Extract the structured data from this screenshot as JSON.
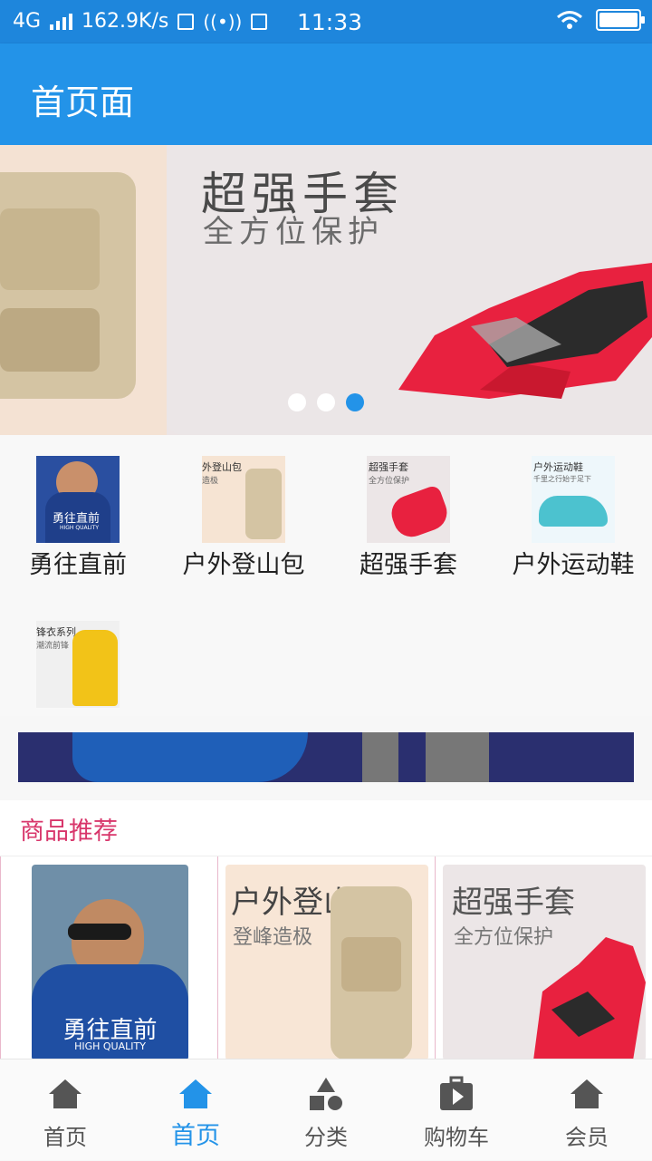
{
  "status_bar": {
    "network": "4G",
    "speed": "162.9K/s",
    "time": "11:33"
  },
  "app_bar": {
    "title": "首页面"
  },
  "banner": {
    "headline": "超强手套",
    "subline": "全方位保护",
    "slide_count": 3,
    "active_slide": 3
  },
  "categories": [
    {
      "label": "勇往直前",
      "thumb_text": "勇往直前",
      "thumb_sub": "HIGH QUALITY"
    },
    {
      "label": "户外登山包",
      "thumb_text": "外登山包",
      "thumb_sub": "造极"
    },
    {
      "label": "超强手套",
      "thumb_text": "超强手套",
      "thumb_sub": "全方位保护"
    },
    {
      "label": "户外运动鞋",
      "thumb_text": "户外运动鞋",
      "thumb_sub": "千里之行始于足下"
    },
    {
      "label": "",
      "thumb_text": "锋衣系列",
      "thumb_sub": "潮流前锋"
    }
  ],
  "recommend": {
    "title": "商品推荐",
    "items": [
      {
        "headline": "勇往直前",
        "sub": "HIGH QUALITY"
      },
      {
        "headline": "户外登山包",
        "sub": "登峰造极"
      },
      {
        "headline": "超强手套",
        "sub": "全方位保护"
      }
    ]
  },
  "bottom_nav": [
    {
      "label": "首页",
      "icon": "home-icon",
      "active": false
    },
    {
      "label": "首页",
      "icon": "home-icon",
      "active": true
    },
    {
      "label": "分类",
      "icon": "shapes-icon",
      "active": false
    },
    {
      "label": "购物车",
      "icon": "shopping-bag-icon",
      "active": false
    },
    {
      "label": "会员",
      "icon": "home-icon",
      "active": false
    }
  ],
  "colors": {
    "status_bar": "#1e86dc",
    "app_bar": "#2393e8",
    "accent": "#2393e8",
    "recommend_title": "#d8366b"
  }
}
